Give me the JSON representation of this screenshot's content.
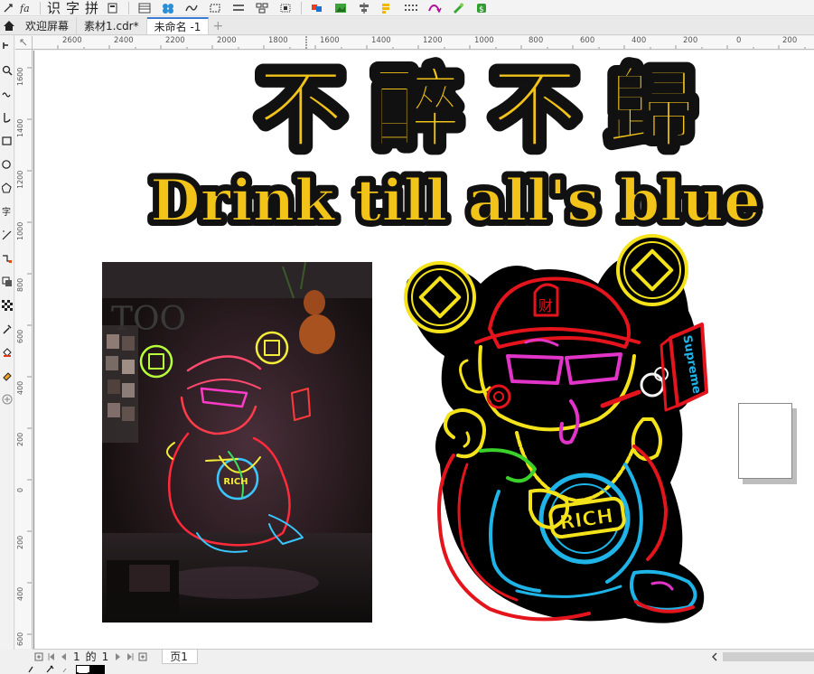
{
  "toolbar": {
    "text_tools": [
      "识",
      "字",
      "拼"
    ],
    "icons": [
      "text-tool-icon",
      "layout-icon",
      "table-icon",
      "node-icon",
      "effects-icon",
      "grid-icon",
      "group-icon",
      "color-icon",
      "image-icon",
      "align-icon",
      "palette-icon",
      "pattern-icon",
      "transform-icon",
      "plugin-icon",
      "macro-icon"
    ]
  },
  "tabs": {
    "items": [
      {
        "label": "欢迎屏幕"
      },
      {
        "label": "素材1.cdr*"
      },
      {
        "label": "未命名 -1"
      }
    ],
    "active_index": 2,
    "add_label": "+"
  },
  "ruler": {
    "top_labels": [
      "2600",
      "2400",
      "2200",
      "2000",
      "1800",
      "1600",
      "1400",
      "1200",
      "1000",
      "800",
      "600",
      "400",
      "200",
      "0",
      "200"
    ],
    "left_labels": [
      "1600",
      "1400",
      "1200",
      "1000",
      "800",
      "600",
      "400",
      "200",
      "0",
      "200",
      "400",
      "600"
    ]
  },
  "artwork": {
    "title_cn": "不 醉 不 歸",
    "title_en": "Drink till all's blue",
    "badge_text": "RICH",
    "sign_text": "Supreme",
    "photo_sign_text": "TOO",
    "colors": {
      "title_fill": "#f2c318",
      "outline": "#111111",
      "neon_red": "#e3141c",
      "neon_yellow": "#f4e21a",
      "neon_pink": "#e234c9",
      "neon_cyan": "#1fb4e8",
      "neon_green": "#3ad12a",
      "neon_white": "#f5f5f5"
    }
  },
  "pagebar": {
    "current": "1",
    "of": "的",
    "total": "1",
    "page_tab": "页1"
  }
}
